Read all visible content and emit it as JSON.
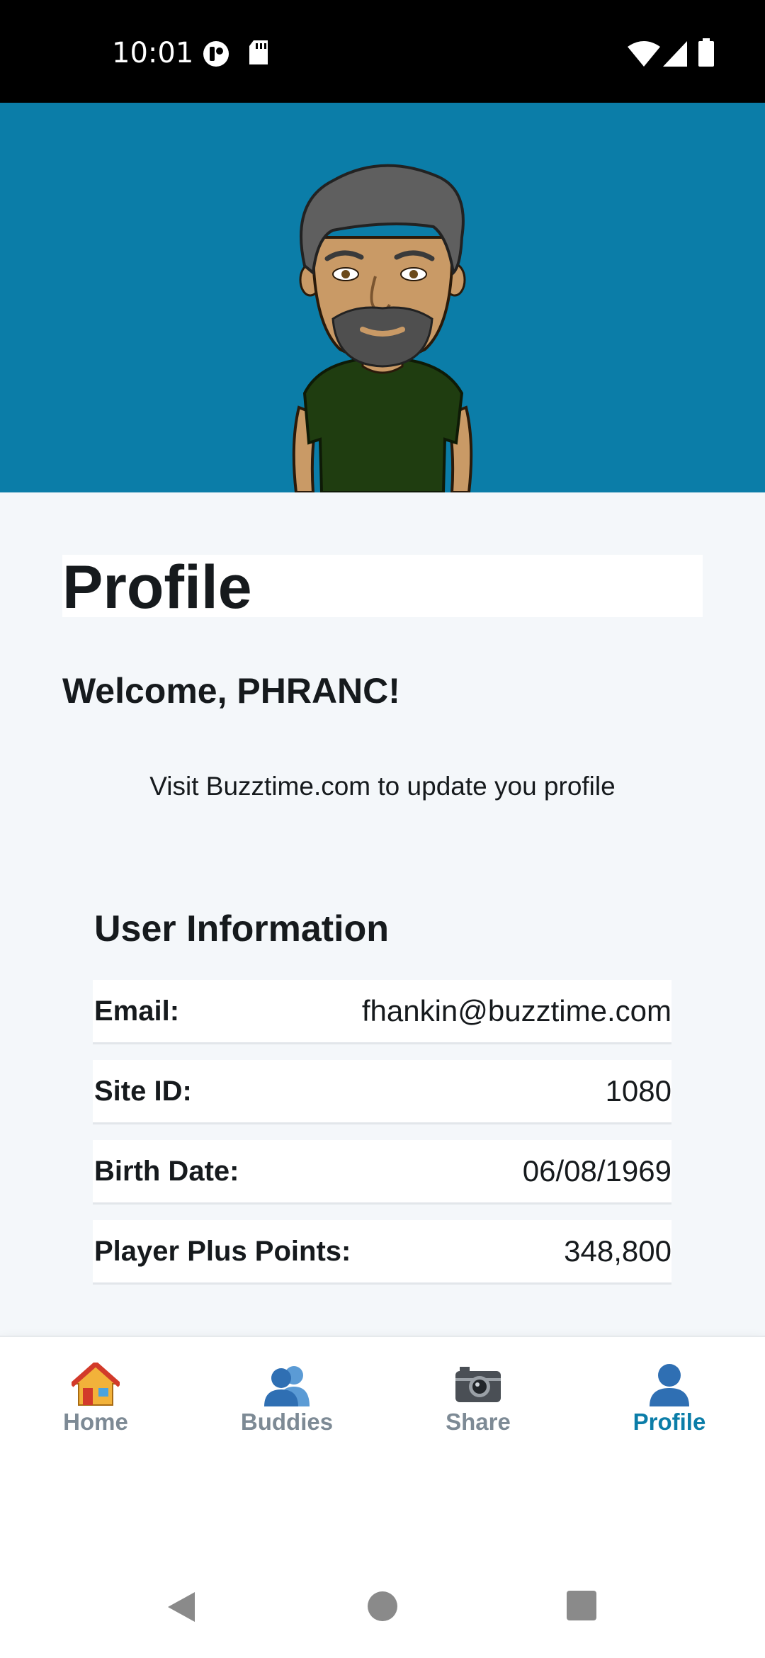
{
  "status_bar": {
    "time": "10:01",
    "icons": [
      "notification-app-icon",
      "sd-card-icon",
      "wifi-icon",
      "signal-icon",
      "battery-icon"
    ]
  },
  "banner": {
    "background_color": "#0b7da8",
    "avatar": "user-avatar-illustration"
  },
  "page": {
    "title": "Profile",
    "welcome": "Welcome, PHRANC!",
    "note": "Visit Buzztime.com to update you profile"
  },
  "user_info": {
    "section_title": "User Information",
    "rows": [
      {
        "label": "Email:",
        "value": "fhankin@buzztime.com"
      },
      {
        "label": "Site ID:",
        "value": "1080"
      },
      {
        "label": "Birth Date:",
        "value": "06/08/1969"
      },
      {
        "label": "Player Plus Points:",
        "value": "348,800"
      }
    ]
  },
  "tabs": [
    {
      "label": "Home",
      "icon": "house-icon",
      "active": false
    },
    {
      "label": "Buddies",
      "icon": "people-icon",
      "active": false
    },
    {
      "label": "Share",
      "icon": "camera-icon",
      "active": false
    },
    {
      "label": "Profile",
      "icon": "person-icon",
      "active": true
    }
  ],
  "colors": {
    "accent": "#0b7da8",
    "inactive_tab": "#7d8a95",
    "text": "#161a1d"
  },
  "nav_bar": {
    "buttons": [
      "back-icon",
      "home-circle-icon",
      "recents-square-icon"
    ]
  }
}
